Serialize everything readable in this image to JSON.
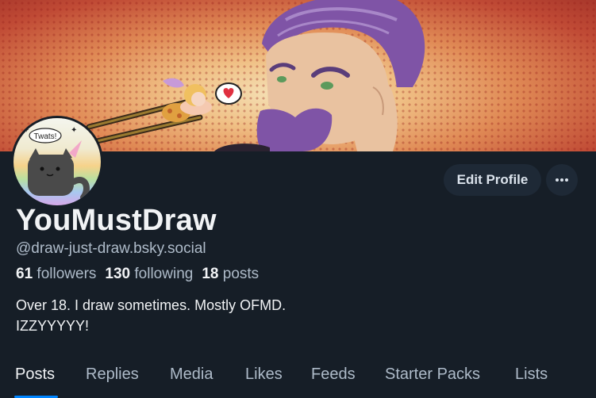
{
  "profile": {
    "display_name": "YouMustDraw",
    "handle": "@draw-just-draw.bsky.social",
    "followers_count": "61",
    "followers_label": "followers",
    "following_count": "130",
    "following_label": "following",
    "posts_count": "18",
    "posts_label": "posts",
    "bio_line1": "Over 18. I draw sometimes. Mostly OFMD.",
    "bio_line2": "IZZYYYYY!",
    "avatar_text": "Twats!"
  },
  "actions": {
    "edit_label": "Edit Profile",
    "more_icon": "ellipsis-icon"
  },
  "tabs": [
    {
      "label": "Posts",
      "active": true
    },
    {
      "label": "Replies"
    },
    {
      "label": "Media"
    },
    {
      "label": "Likes"
    },
    {
      "label": "Feeds"
    },
    {
      "label": "Starter Packs"
    },
    {
      "label": "Lists"
    }
  ],
  "colors": {
    "background": "#161e27",
    "accent": "#0085ff",
    "muted_text": "#aebbc9",
    "button_bg": "#1e2936"
  }
}
